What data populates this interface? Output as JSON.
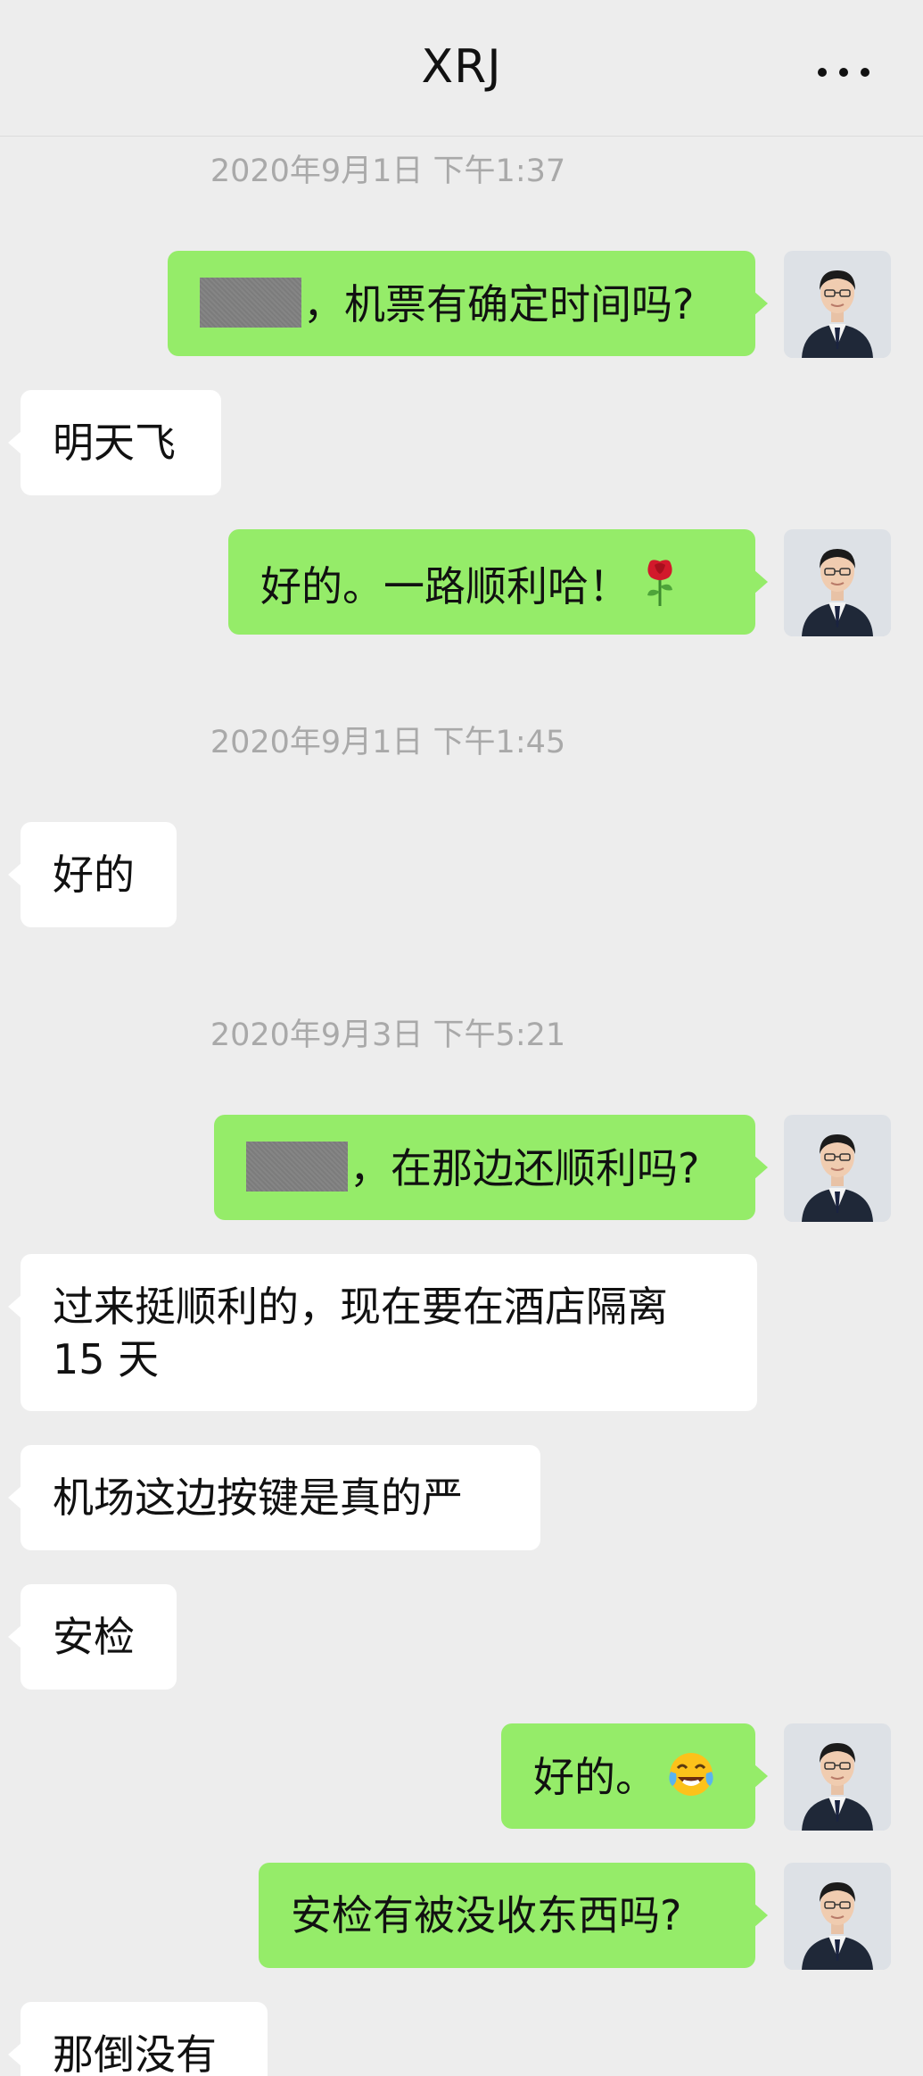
{
  "header": {
    "title": "XRJ"
  },
  "timestamps": [
    "2020年9月1日 下午1:37",
    "2020年9月1日 下午1:45",
    "2020年9月3日 下午5:21"
  ],
  "messages": [
    {
      "side": "sent",
      "text": "，机票有确定时间吗?",
      "redacted": true
    },
    {
      "side": "recv",
      "text": "明天飞"
    },
    {
      "side": "sent",
      "text": "好的。一路顺利哈！",
      "emoji": "rose-icon"
    },
    {
      "side": "recv",
      "text": "好的"
    },
    {
      "side": "sent",
      "text": "，在那边还顺利吗?",
      "redacted": true
    },
    {
      "side": "recv",
      "line1": "过来挺顺利的，现在要在酒店隔离",
      "line2": "15 天"
    },
    {
      "side": "recv",
      "text": "机场这边按键是真的严"
    },
    {
      "side": "recv",
      "text": "安检"
    },
    {
      "side": "sent",
      "text": "好的。",
      "emoji": "tears-of-joy-icon"
    },
    {
      "side": "sent",
      "text": "安检有被没收东西吗?"
    },
    {
      "side": "recv",
      "text": "那倒没有"
    }
  ],
  "colors": {
    "background": "#ededed",
    "sent_bubble": "#95ec69",
    "received_bubble": "#ffffff",
    "timestamp": "#a9a9a9"
  }
}
